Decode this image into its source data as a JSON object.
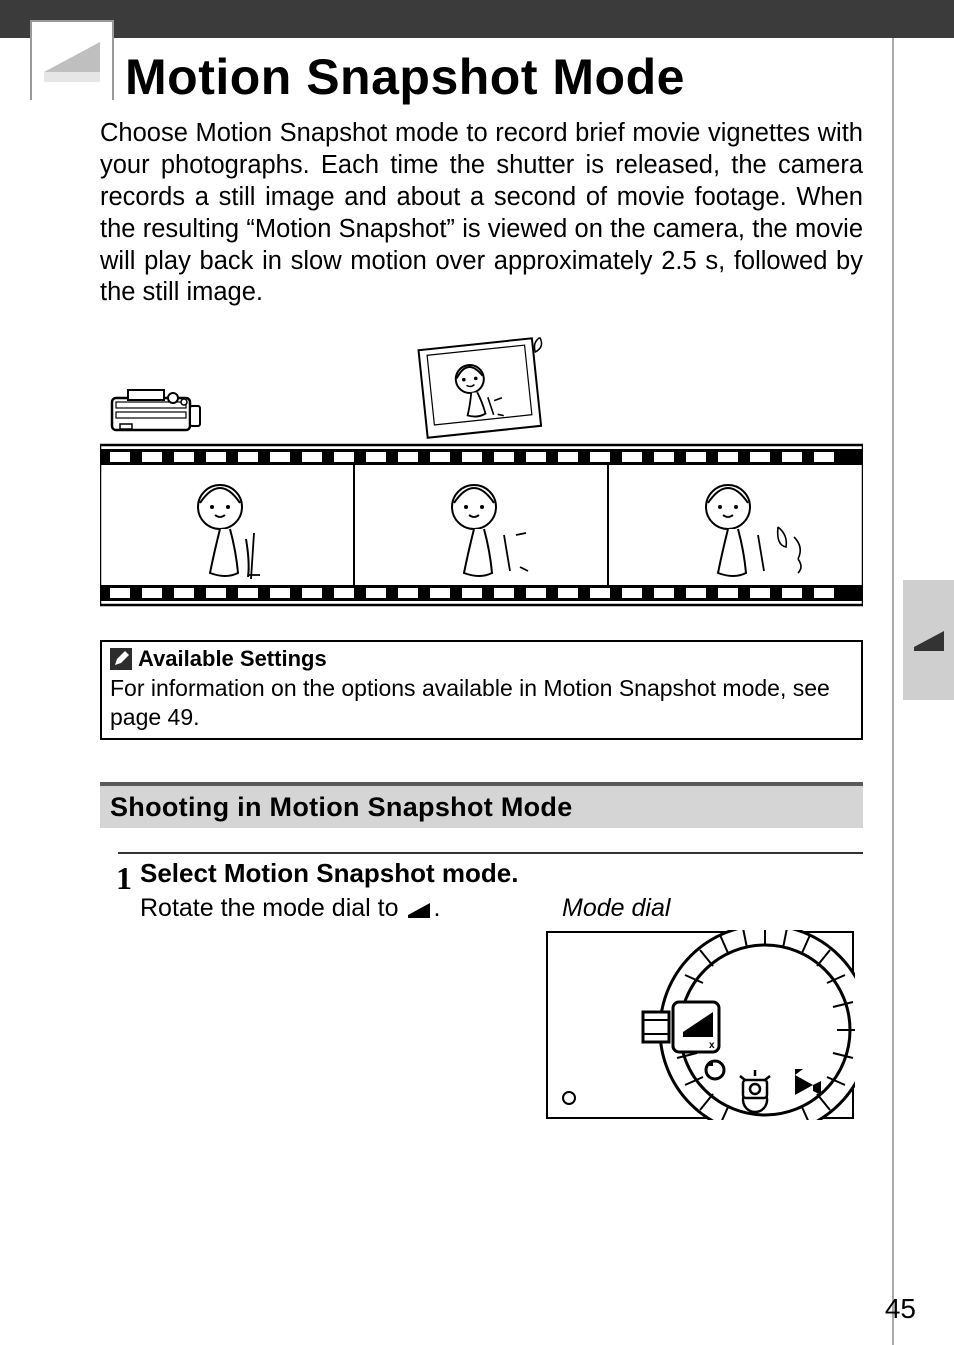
{
  "title": "Motion Snapshot Mode",
  "intro": "Choose Motion Snapshot mode to record brief movie vignettes with your photographs. Each time the shutter is released, the camera records a still image and about a second of movie footage. When the resulting “Motion Snapshot” is viewed on the camera, the movie will play back in slow motion over approximately 2.5 s, followed by the still image.",
  "note": {
    "title": "Available Settings",
    "body": "For information on the options available in Motion Snapshot mode, see page 49."
  },
  "section": "Shooting in Motion Snapshot Mode",
  "step1": {
    "num": "1",
    "title": "Select Motion Snapshot mode.",
    "body_before": "Rotate the mode dial to ",
    "body_after": ".",
    "fig_caption": "Mode dial"
  },
  "page_number": "45"
}
